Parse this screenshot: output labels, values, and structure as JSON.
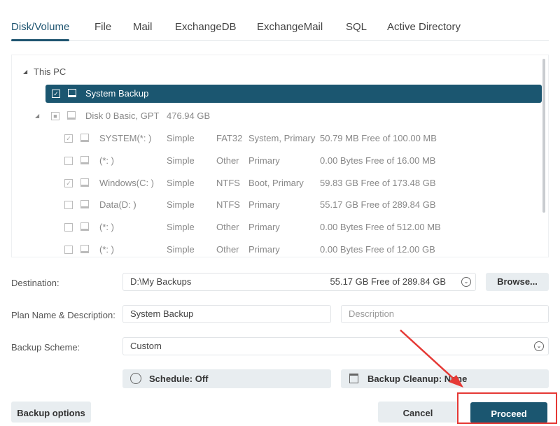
{
  "tabs": [
    "Disk/Volume",
    "File",
    "Mail",
    "ExchangeDB",
    "ExchangeMail",
    "SQL",
    "Active Directory"
  ],
  "tree": {
    "root": "This PC",
    "selected": "System Backup",
    "disk": {
      "name": "Disk 0 Basic, GPT",
      "size": "476.94 GB"
    },
    "partitions": [
      {
        "name": "SYSTEM(*: )",
        "type": "Simple",
        "fs": "FAT32",
        "status": "System, Primary",
        "free": "50.79 MB Free of 100.00 MB",
        "checked": true
      },
      {
        "name": "(*: )",
        "type": "Simple",
        "fs": "Other",
        "status": "Primary",
        "free": "0.00 Bytes Free of 16.00 MB",
        "checked": false
      },
      {
        "name": "Windows(C: )",
        "type": "Simple",
        "fs": "NTFS",
        "status": "Boot, Primary",
        "free": "59.83 GB Free of 173.48 GB",
        "checked": true
      },
      {
        "name": "Data(D: )",
        "type": "Simple",
        "fs": "NTFS",
        "status": "Primary",
        "free": "55.17 GB Free of 289.84 GB",
        "checked": false
      },
      {
        "name": "(*: )",
        "type": "Simple",
        "fs": "Other",
        "status": "Primary",
        "free": "0.00 Bytes Free of 512.00 MB",
        "checked": false
      },
      {
        "name": "(*: )",
        "type": "Simple",
        "fs": "Other",
        "status": "Primary",
        "free": "0.00 Bytes Free of 12.00 GB",
        "checked": false
      }
    ]
  },
  "form": {
    "destination_label": "Destination:",
    "destination": "D:\\My Backups",
    "destination_free": "55.17 GB Free of 289.84 GB",
    "browse": "Browse...",
    "plan_label": "Plan Name & Description:",
    "plan_name": "System Backup",
    "description_placeholder": "Description",
    "scheme_label": "Backup Scheme:",
    "scheme": "Custom",
    "schedule": "Schedule: Off",
    "cleanup": "Backup Cleanup: None"
  },
  "buttons": {
    "options": "Backup options",
    "cancel": "Cancel",
    "proceed": "Proceed"
  },
  "colors": {
    "accent": "#1b5670",
    "annotation": "#e53935"
  }
}
